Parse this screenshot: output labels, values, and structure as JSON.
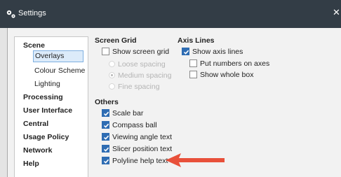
{
  "window": {
    "title": "Settings",
    "close_glyph": "✕",
    "app_icon": "settings-app-icon"
  },
  "nav": {
    "items": [
      {
        "label": "Scene",
        "level": "top",
        "bold": true
      },
      {
        "label": "Overlays",
        "level": "sub",
        "selected": true
      },
      {
        "label": "Colour Scheme",
        "level": "sub"
      },
      {
        "label": "Lighting",
        "level": "sub"
      },
      {
        "label": "Processing",
        "level": "top",
        "bold": true
      },
      {
        "label": "User Interface",
        "level": "top",
        "bold": true
      },
      {
        "label": "Central",
        "level": "top",
        "bold": true
      },
      {
        "label": "Usage Policy",
        "level": "top",
        "bold": true
      },
      {
        "label": "Network",
        "level": "top",
        "bold": true
      },
      {
        "label": "Help",
        "level": "top",
        "bold": true
      }
    ]
  },
  "screen_grid": {
    "title": "Screen Grid",
    "show_screen_grid": {
      "label": "Show screen grid",
      "checked": false
    },
    "spacing_options": [
      {
        "label": "Loose spacing",
        "selected": false,
        "enabled": false
      },
      {
        "label": "Medium spacing",
        "selected": true,
        "enabled": false
      },
      {
        "label": "Fine spacing",
        "selected": false,
        "enabled": false
      }
    ]
  },
  "axis_lines": {
    "title": "Axis Lines",
    "show_axis_lines": {
      "label": "Show axis lines",
      "checked": true
    },
    "put_numbers_on_axes": {
      "label": "Put numbers on axes",
      "checked": false
    },
    "show_whole_box": {
      "label": "Show whole box",
      "checked": false
    }
  },
  "others": {
    "title": "Others",
    "items": [
      {
        "label": "Scale bar",
        "checked": true
      },
      {
        "label": "Compass ball",
        "checked": true
      },
      {
        "label": "Viewing angle text",
        "checked": true
      },
      {
        "label": "Slicer position text",
        "checked": true
      },
      {
        "label": "Polyline help text",
        "checked": true
      }
    ]
  },
  "colors": {
    "titlebar": "#333d46",
    "checkbox_checked": "#2f6db3",
    "selection": "#dcebfa",
    "arrow": "#e8503a"
  }
}
